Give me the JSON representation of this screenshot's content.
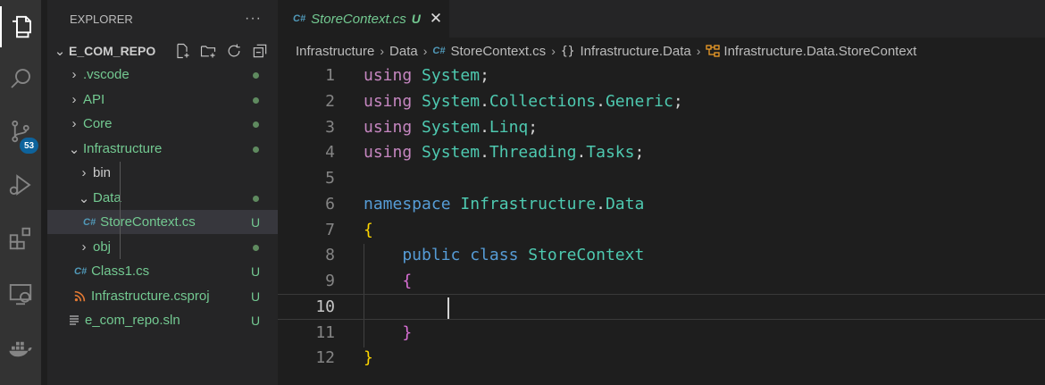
{
  "sidebar": {
    "title": "EXPLORER",
    "more_label": "···",
    "repo": "E_COM_REPO",
    "items": [
      {
        "label": ".vscode",
        "status": "dot"
      },
      {
        "label": "API",
        "status": "dot"
      },
      {
        "label": "Core",
        "status": "dot"
      },
      {
        "label": "Infrastructure",
        "status": "dot"
      },
      {
        "label": "bin",
        "status": ""
      },
      {
        "label": "Data",
        "status": "dot"
      },
      {
        "label": "StoreContext.cs",
        "status": "U"
      },
      {
        "label": "obj",
        "status": "dot"
      },
      {
        "label": "Class1.cs",
        "status": "U"
      },
      {
        "label": "Infrastructure.csproj",
        "status": "U"
      },
      {
        "label": "e_com_repo.sln",
        "status": "U"
      }
    ]
  },
  "activity": {
    "source_control_badge": "53"
  },
  "tab": {
    "icon": "C#",
    "name": "StoreContext.cs",
    "flag": "U",
    "close": "✕"
  },
  "breadcrumb": {
    "parts": [
      "Infrastructure",
      "Data",
      "StoreContext.cs",
      "Infrastructure.Data",
      "Infrastructure.Data.StoreContext"
    ],
    "ns_icon": "{}"
  },
  "editor": {
    "line_numbers": [
      "1",
      "2",
      "3",
      "4",
      "5",
      "6",
      "7",
      "8",
      "9",
      "10",
      "11",
      "12"
    ],
    "current_line": "10"
  },
  "colors": {
    "accent": "#0e639c",
    "untracked": "#73c991",
    "keyword": "#c586c0",
    "type": "#4ec9b0",
    "keyword_blue": "#569cd6"
  }
}
